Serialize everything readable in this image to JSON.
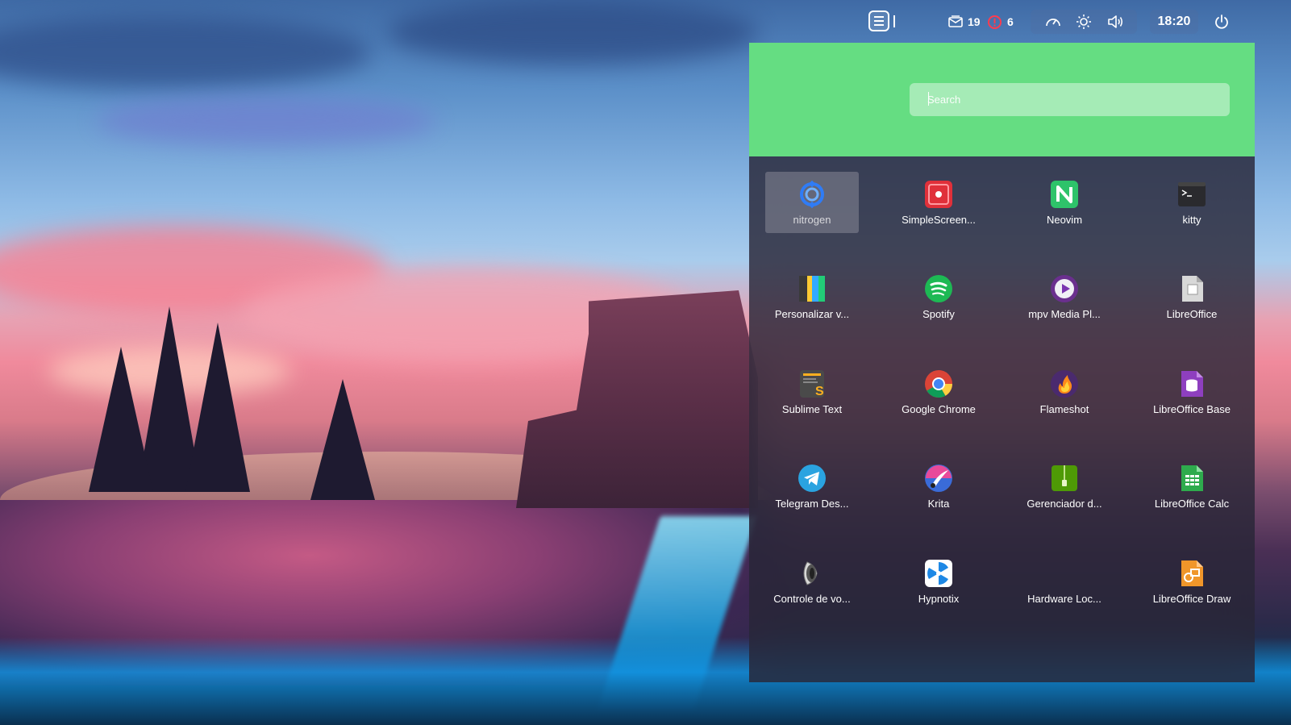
{
  "topbar": {
    "menu_icon": "hamburger-menu-icon",
    "mail_count": "19",
    "alert_count": "6",
    "clock": "18:20",
    "icons": [
      "mail-icon",
      "alert-icon",
      "speedometer-icon",
      "brightness-icon",
      "volume-icon",
      "power-icon"
    ]
  },
  "launcher": {
    "header_color": "#65dd82",
    "search": {
      "placeholder": "Search",
      "value": ""
    },
    "apps": [
      {
        "label": "nitrogen",
        "icon": "nitrogen-icon"
      },
      {
        "label": "SimpleScreen...",
        "icon": "simplescreenrecorder-icon"
      },
      {
        "label": "Neovim",
        "icon": "neovim-icon"
      },
      {
        "label": "kitty",
        "icon": "terminal-icon"
      },
      {
        "label": "Personalizar v...",
        "icon": "personalizar-icon"
      },
      {
        "label": "Spotify",
        "icon": "spotify-icon"
      },
      {
        "label": "mpv Media Pl...",
        "icon": "mpv-icon"
      },
      {
        "label": "LibreOffice",
        "icon": "libreoffice-icon"
      },
      {
        "label": "Sublime Text",
        "icon": "sublime-text-icon"
      },
      {
        "label": "Google Chrome",
        "icon": "chrome-icon"
      },
      {
        "label": "Flameshot",
        "icon": "flameshot-icon"
      },
      {
        "label": "LibreOffice Base",
        "icon": "libreoffice-base-icon"
      },
      {
        "label": "Telegram Des...",
        "icon": "telegram-icon"
      },
      {
        "label": "Krita",
        "icon": "krita-icon"
      },
      {
        "label": "Gerenciador d...",
        "icon": "archive-manager-icon"
      },
      {
        "label": "LibreOffice Calc",
        "icon": "libreoffice-calc-icon"
      },
      {
        "label": "Controle de vo...",
        "icon": "volume-control-icon"
      },
      {
        "label": "Hypnotix",
        "icon": "hypnotix-icon"
      },
      {
        "label": "Hardware Loc...",
        "icon": "hardware-locale-icon"
      },
      {
        "label": "LibreOffice Draw",
        "icon": "libreoffice-draw-icon"
      }
    ]
  }
}
